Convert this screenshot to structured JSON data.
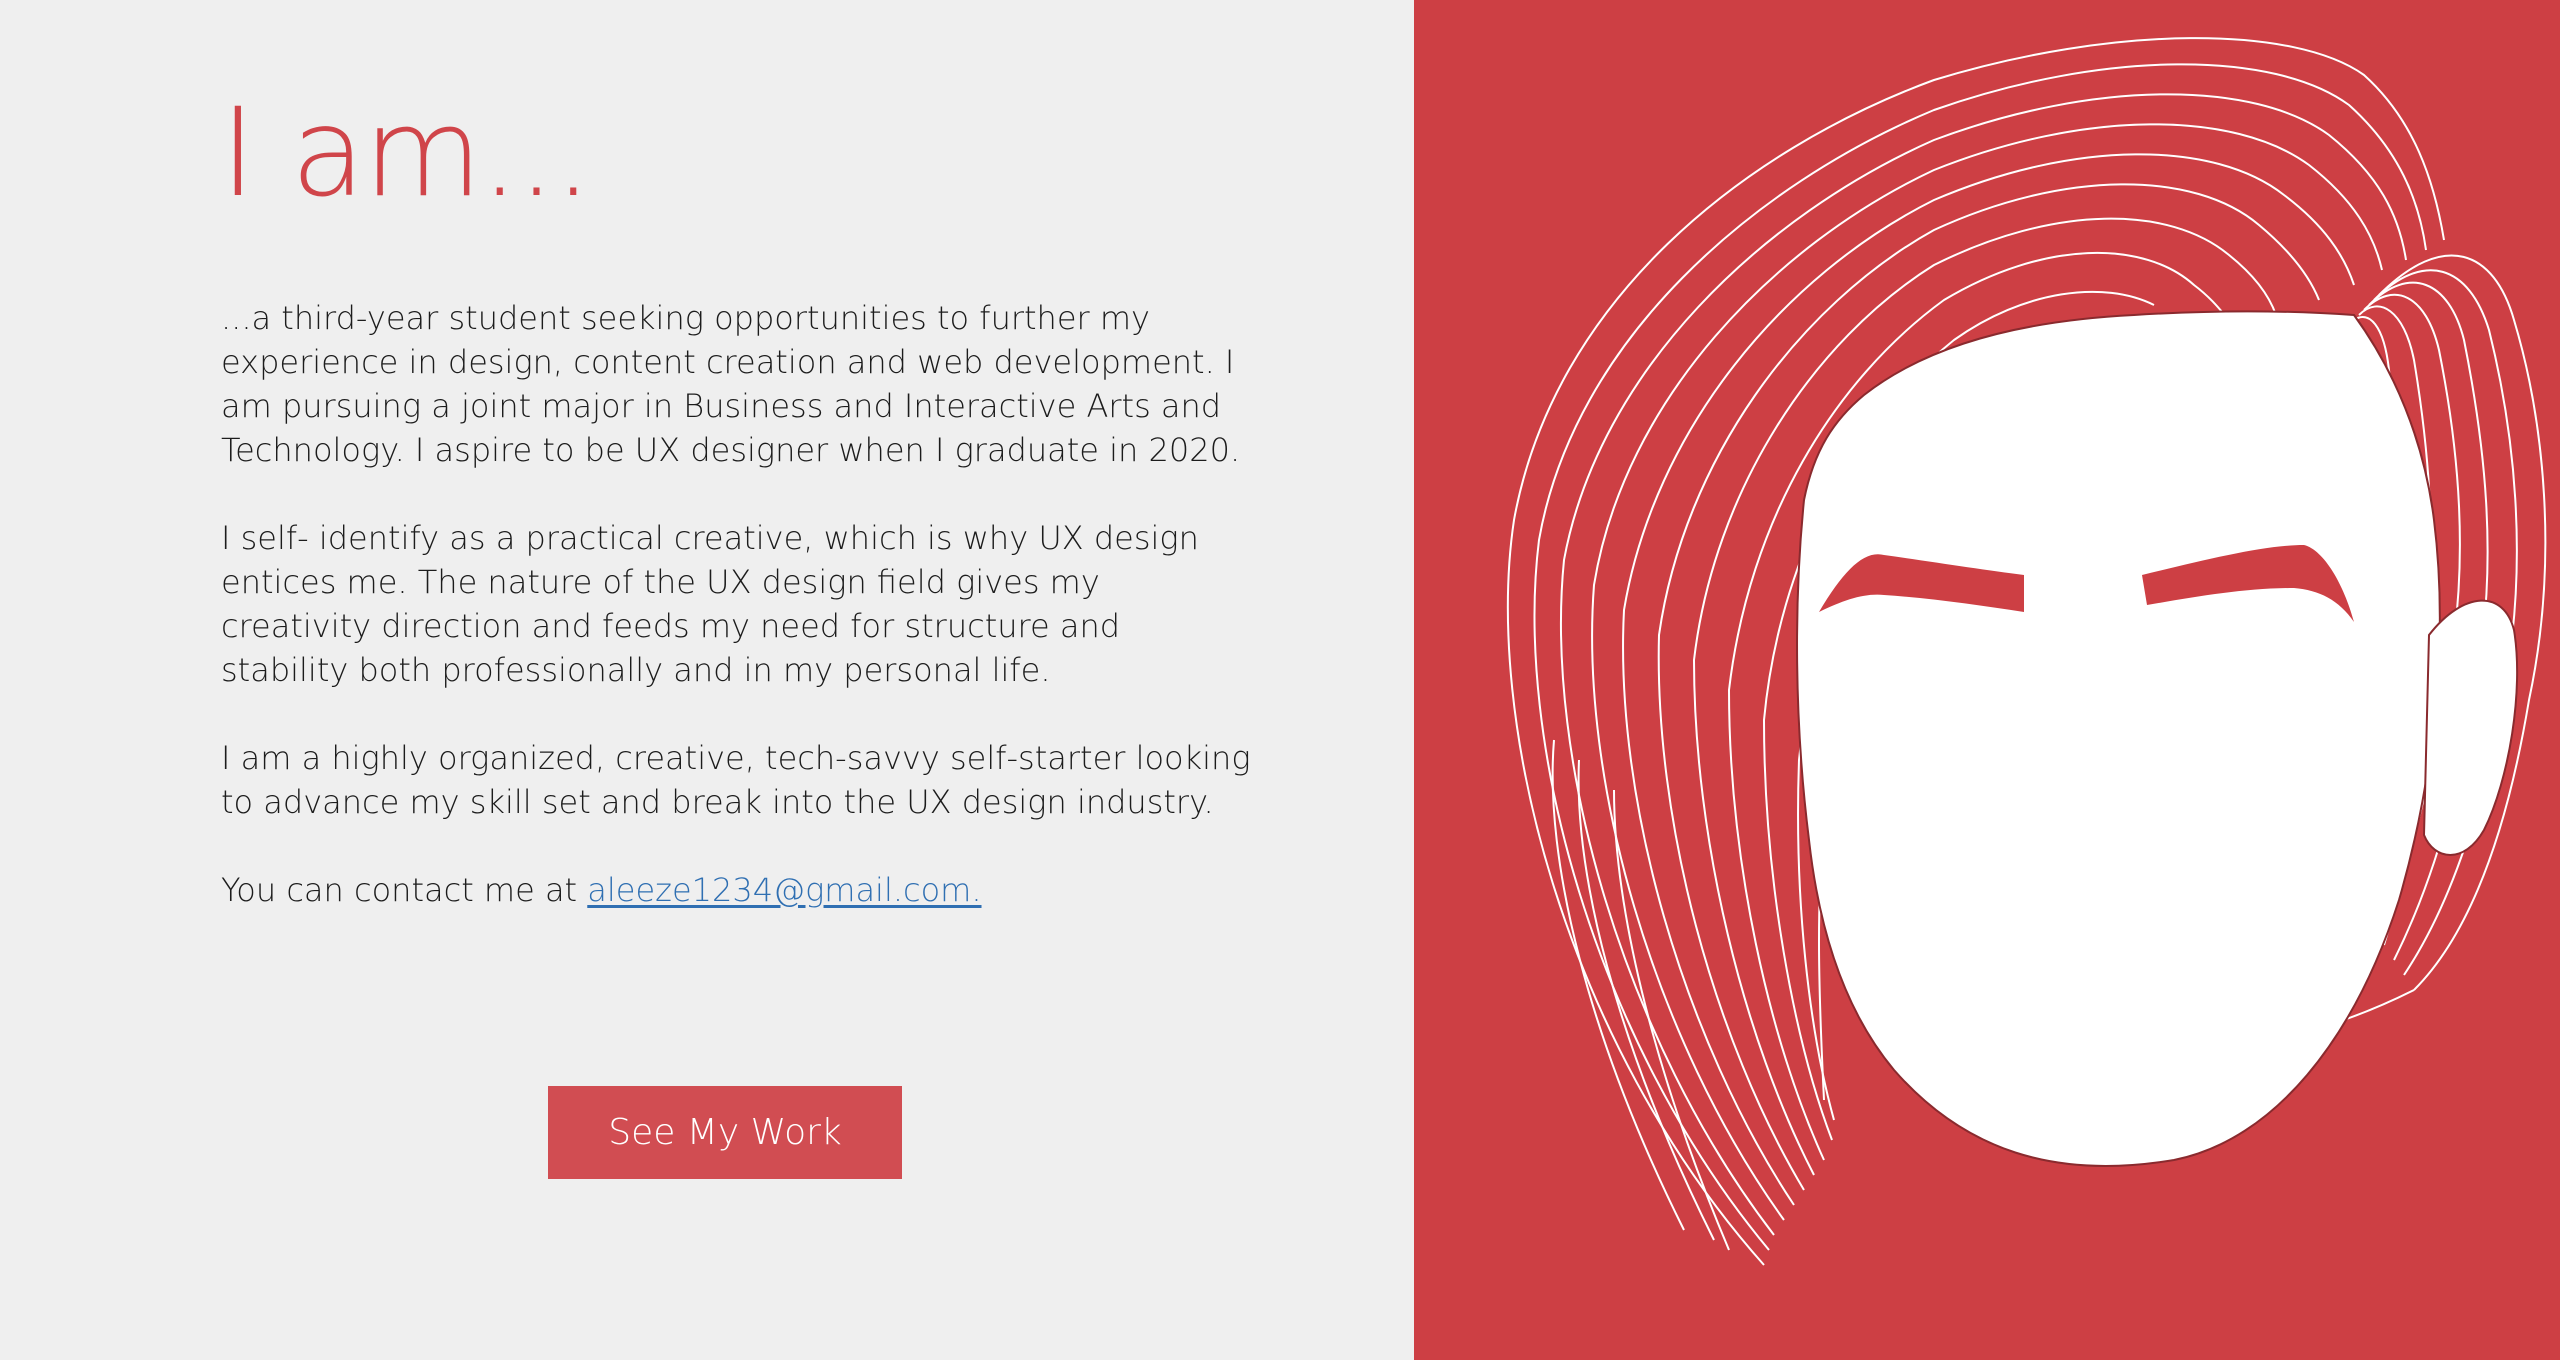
{
  "intro": {
    "heading": "I am..."
  },
  "bio": {
    "paragraph_1": "...a third-year student seeking opportunities to further my experience in design, content creation and web development. I am pursuing a joint major in Business and Interactive Arts and Technology. I aspire to be UX designer when I graduate in 2020.",
    "paragraph_2": "I self- identify as a practical creative, which is why UX design entices me. The nature of the UX design field gives my creativity direction and feeds my need for structure and stability both professionally and in my personal life.",
    "paragraph_3": "I am a highly organized, creative, tech-savvy self-starter looking to advance my skill set and break into the UX design industry.",
    "contact_prefix": "You can contact me at ",
    "contact_email": "aleeze1234@gmail.com."
  },
  "cta": {
    "label": "See My Work"
  },
  "colors": {
    "accent": "#cd3f44",
    "button": "#d14d52",
    "link": "#2f6fb2",
    "background": "#efefef"
  },
  "illustration": {
    "icon": "face-portrait-illustration"
  }
}
